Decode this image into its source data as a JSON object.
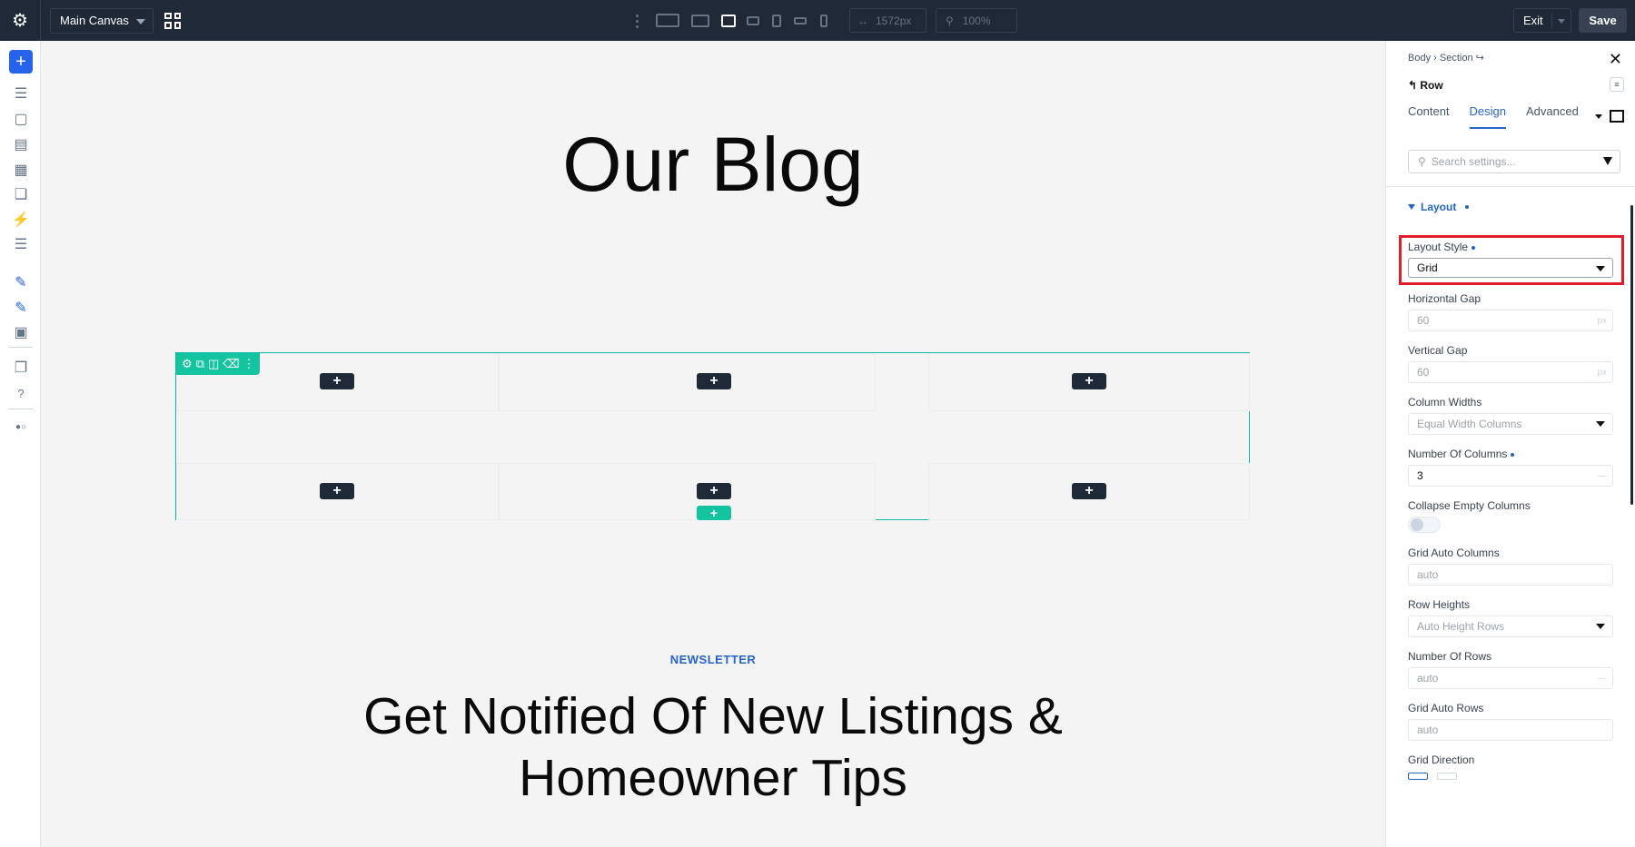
{
  "topbar": {
    "canvas_select": "Main Canvas",
    "width_value": "1572px",
    "zoom_value": "100%",
    "exit_label": "Exit",
    "save_label": "Save"
  },
  "canvas": {
    "blog_title": "Our Blog",
    "newsletter_label": "NEWSLETTER",
    "cta_heading_line1": "Get Notified Of New Listings &",
    "cta_heading_line2": "Homeowner Tips",
    "plus": "+"
  },
  "panel": {
    "crumb_body": "Body",
    "crumb_section": "Section",
    "element_label": "Row",
    "tabs": [
      {
        "label": "Content"
      },
      {
        "label": "Design"
      },
      {
        "label": "Advanced"
      }
    ],
    "search_placeholder": "Search settings...",
    "section_layout": "Layout",
    "fields": {
      "layout_style": {
        "label": "Layout Style",
        "value": "Grid"
      },
      "horizontal_gap": {
        "label": "Horizontal Gap",
        "value": "60",
        "unit": "px"
      },
      "vertical_gap": {
        "label": "Vertical Gap",
        "value": "60",
        "unit": "px"
      },
      "column_widths": {
        "label": "Column Widths",
        "value": "Equal Width Columns"
      },
      "number_of_columns": {
        "label": "Number Of Columns",
        "value": "3"
      },
      "collapse_empty": {
        "label": "Collapse Empty Columns",
        "enabled": false
      },
      "grid_auto_columns": {
        "label": "Grid Auto Columns",
        "value": "auto"
      },
      "row_heights": {
        "label": "Row Heights",
        "value": "Auto Height Rows"
      },
      "number_of_rows": {
        "label": "Number Of Rows",
        "value": "auto"
      },
      "grid_auto_rows": {
        "label": "Grid Auto Rows",
        "value": "auto"
      },
      "grid_direction": {
        "label": "Grid Direction"
      }
    }
  }
}
